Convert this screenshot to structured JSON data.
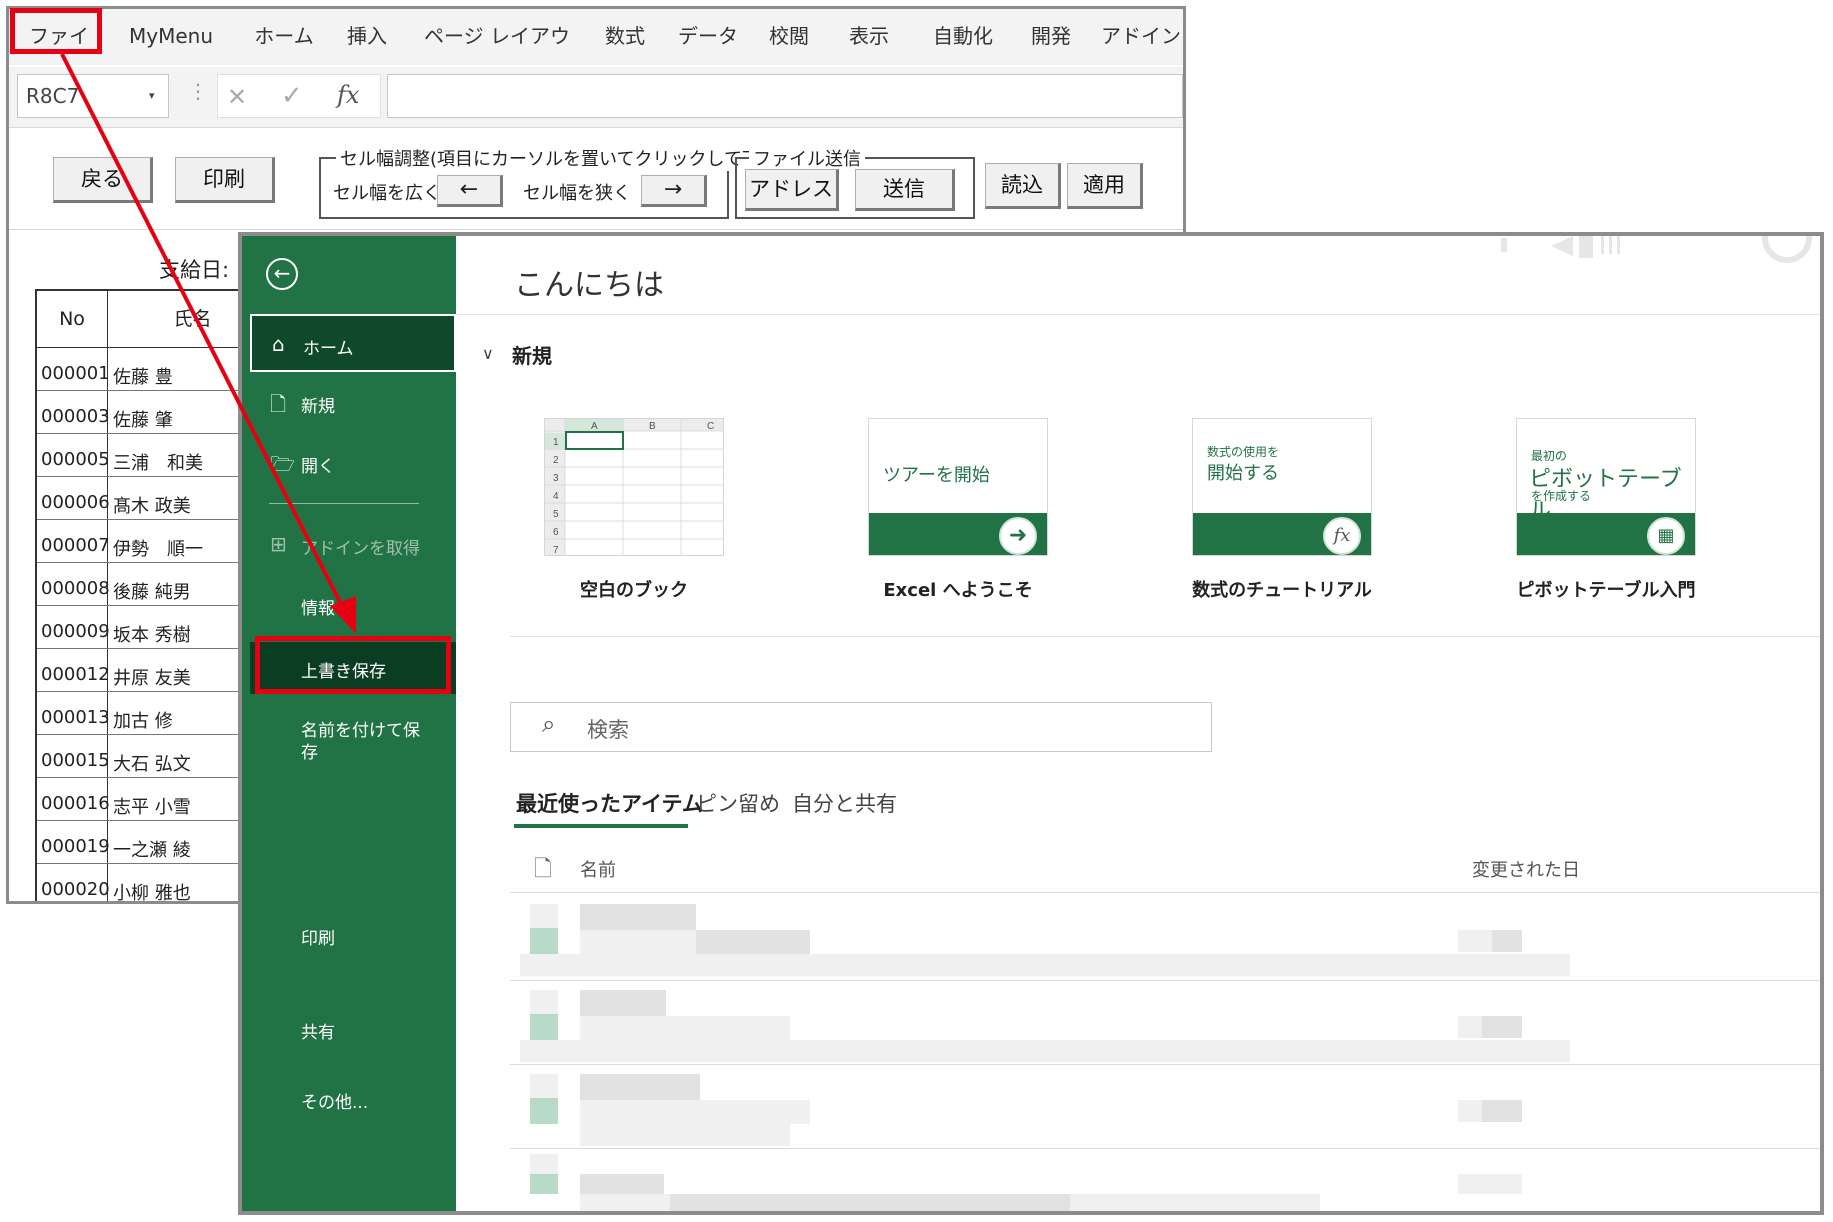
{
  "back_window": {
    "ribbon_tabs": [
      "ファイル",
      "MyMenu",
      "ホーム",
      "挿入",
      "ページ レイアウト",
      "数式",
      "データ",
      "校閲",
      "表示",
      "自動化",
      "開発",
      "アドイン"
    ],
    "name_box": "R8C7",
    "formula_bar": {
      "cancel": "✕",
      "enter": "✓",
      "fx": "fx"
    },
    "buttons": {
      "back": "戻る",
      "print": "印刷",
      "col_group_title": "セル幅調整(項目にカーソルを置いてクリックして下さい)",
      "widen_label": "セル幅を広く",
      "widen_arrow": "←",
      "narrow_label": "セル幅を狭く",
      "narrow_arrow": "→",
      "send_group_title": "ファイル送信",
      "address": "アドレス",
      "send": "送信",
      "load": "読込",
      "apply": "適用"
    },
    "pay_date_label": "支給日:",
    "table": {
      "headers": [
        "No",
        "氏名"
      ],
      "rows": [
        {
          "no": "000001",
          "name": "佐藤 豊"
        },
        {
          "no": "000003",
          "name": "佐藤 肇"
        },
        {
          "no": "000005",
          "name": "三浦　和美"
        },
        {
          "no": "000006",
          "name": "髙木 政美"
        },
        {
          "no": "000007",
          "name": "伊勢　順一"
        },
        {
          "no": "000008",
          "name": "後藤 純男"
        },
        {
          "no": "000009",
          "name": "坂本 秀樹"
        },
        {
          "no": "000012",
          "name": "井原 友美"
        },
        {
          "no": "000013",
          "name": "加古 修"
        },
        {
          "no": "000015",
          "name": "大石 弘文"
        },
        {
          "no": "000016",
          "name": "志平 小雪"
        },
        {
          "no": "000019",
          "name": "一之瀬 綾"
        },
        {
          "no": "000020",
          "name": "小柳 雅也"
        }
      ]
    }
  },
  "backstage": {
    "nav": {
      "home": "ホーム",
      "new": "新規",
      "open": "開く",
      "addin": "アドインを取得",
      "info": "情報",
      "save": "上書き保存",
      "save_as_line1": "名前を付けて保",
      "save_as_line2": "存",
      "print": "印刷",
      "share": "共有",
      "more": "その他..."
    },
    "greeting": "こんにちは",
    "new_section": "新規",
    "templates": [
      {
        "label": "空白のブック"
      },
      {
        "label": "Excel へようこそ",
        "thumb_text": "ツアーを開始"
      },
      {
        "label": "数式のチュートリアル",
        "thumb_small": "数式の使用を",
        "thumb_text": "開始する"
      },
      {
        "label": "ピボットテーブル入門",
        "thumb_small": "最初の",
        "thumb_text": "ピボットテーブル",
        "thumb_small2": "を作成する"
      }
    ],
    "blank_grid": {
      "cols": [
        "A",
        "B",
        "C"
      ],
      "rows": [
        "1",
        "2",
        "3",
        "4",
        "5",
        "6",
        "7"
      ]
    },
    "search_placeholder": "検索",
    "tabs": [
      "最近使ったアイテム",
      "ピン留め",
      "自分と共有"
    ],
    "list_header": {
      "name": "名前",
      "modified": "変更された日"
    }
  },
  "colors": {
    "excel_green": "#217346",
    "highlight_red": "#e60012"
  }
}
